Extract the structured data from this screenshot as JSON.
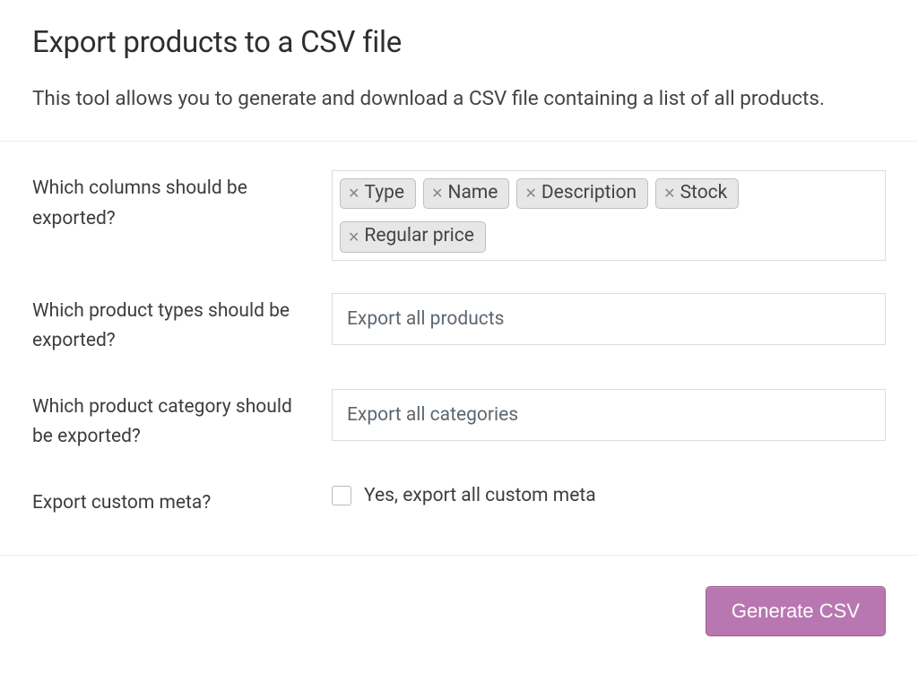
{
  "header": {
    "title": "Export products to a CSV file",
    "subtitle": "This tool allows you to generate and download a CSV file containing a list of all products."
  },
  "form": {
    "columns": {
      "label": "Which columns should be exported?",
      "tags": [
        "Type",
        "Name",
        "Description",
        "Stock",
        "Regular price"
      ]
    },
    "types": {
      "label": "Which product types should be exported?",
      "placeholder": "Export all products"
    },
    "category": {
      "label": "Which product category should be exported?",
      "placeholder": "Export all categories"
    },
    "meta": {
      "label": "Export custom meta?",
      "checkbox_label": "Yes, export all custom meta",
      "checked": false
    }
  },
  "actions": {
    "generate": "Generate CSV"
  }
}
